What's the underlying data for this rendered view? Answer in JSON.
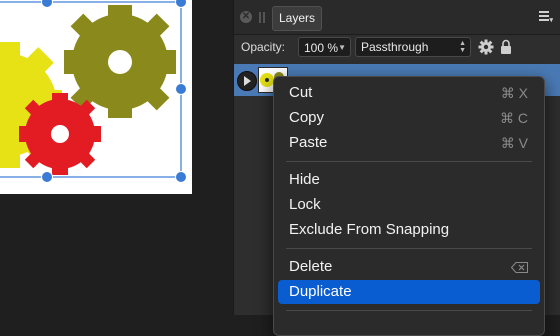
{
  "panel": {
    "tab_label": "Layers",
    "close_icon": "close-icon",
    "opacity_label": "Opacity:",
    "opacity_value": "100 %",
    "blend_mode": "Passthrough"
  },
  "context_menu": {
    "items": [
      {
        "label": "Cut",
        "shortcut": "⌘ X"
      },
      {
        "label": "Copy",
        "shortcut": "⌘ C"
      },
      {
        "label": "Paste",
        "shortcut": "⌘ V"
      },
      {
        "label": "Hide"
      },
      {
        "label": "Lock"
      },
      {
        "label": "Exclude From Snapping"
      },
      {
        "label": "Delete",
        "shortcut_icon": "delete-backspace-icon"
      },
      {
        "label": "Duplicate",
        "highlighted": true
      }
    ]
  },
  "colors": {
    "gear_yellow": "#e6e215",
    "gear_olive": "#8a8a1c",
    "gear_red": "#e31b23",
    "selection": "#3a7bd5",
    "layer_row": "#4a7ab5",
    "menu_highlight": "#0a5dd1"
  }
}
